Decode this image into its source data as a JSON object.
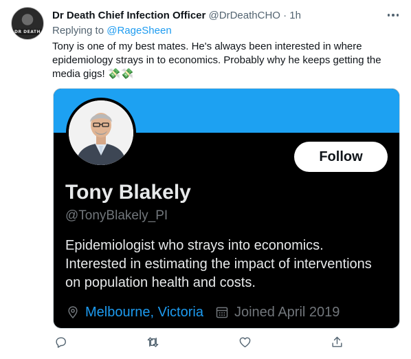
{
  "tweet": {
    "author_name": "Dr Death Chief Infection Officer",
    "author_handle": "@DrDeathCHO",
    "separator": "·",
    "timestamp": "1h",
    "avatar_text": "DR DEATH",
    "replying_prefix": "Replying to",
    "replying_to": "@RageSheen",
    "text": "Tony is one of my best mates. He's always been interested in where epidemiology strays in to economics. Probably why he keeps getting the media gigs! 💸💸"
  },
  "card": {
    "banner_color": "#1da1f2",
    "follow_label": "Follow",
    "name": "Tony Blakely",
    "handle": "@TonyBlakely_PI",
    "bio": "Epidemiologist who strays into economics. Interested in estimating the impact of interventions on population health and costs.",
    "location": "Melbourne, Victoria",
    "joined": "Joined April 2019"
  },
  "actions": {
    "icons": [
      "reply-icon",
      "retweet-icon",
      "like-icon",
      "share-icon"
    ]
  },
  "colors": {
    "accent": "#1d9bf0",
    "muted": "#536471",
    "card_bg": "#000000"
  }
}
